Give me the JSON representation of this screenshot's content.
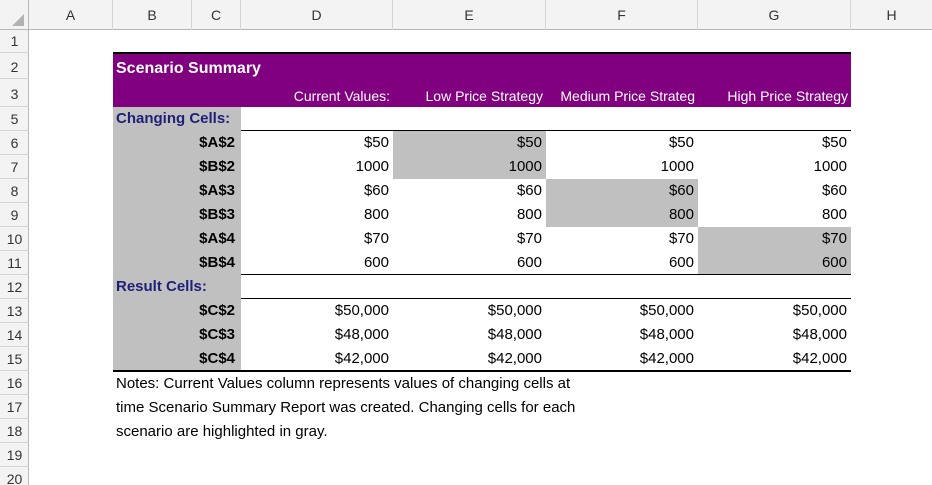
{
  "columns": [
    "A",
    "B",
    "C",
    "D",
    "E",
    "F",
    "G",
    "H"
  ],
  "rows": [
    "1",
    "2",
    "3",
    "5",
    "6",
    "7",
    "8",
    "9",
    "10",
    "11",
    "12",
    "13",
    "14",
    "15",
    "16",
    "17",
    "18",
    "19",
    "20"
  ],
  "report": {
    "title": "Scenario Summary",
    "column_titles": [
      "Current Values:",
      "Low Price Strategy",
      "Medium Price Strateg",
      "High Price Strategy"
    ],
    "changing_label": "Changing Cells:",
    "result_label": "Result Cells:",
    "changing_rows": [
      {
        "cell": "$A$2",
        "values": [
          "$50",
          "$50",
          "$50",
          "$50"
        ]
      },
      {
        "cell": "$B$2",
        "values": [
          "1000",
          "1000",
          "1000",
          "1000"
        ]
      },
      {
        "cell": "$A$3",
        "values": [
          "$60",
          "$60",
          "$60",
          "$60"
        ]
      },
      {
        "cell": "$B$3",
        "values": [
          "800",
          "800",
          "800",
          "800"
        ]
      },
      {
        "cell": "$A$4",
        "values": [
          "$70",
          "$70",
          "$70",
          "$70"
        ]
      },
      {
        "cell": "$B$4",
        "values": [
          "600",
          "600",
          "600",
          "600"
        ]
      }
    ],
    "result_rows": [
      {
        "cell": "$C$2",
        "values": [
          "$50,000",
          "$50,000",
          "$50,000",
          "$50,000"
        ]
      },
      {
        "cell": "$C$3",
        "values": [
          "$48,000",
          "$48,000",
          "$48,000",
          "$48,000"
        ]
      },
      {
        "cell": "$C$4",
        "values": [
          "$42,000",
          "$42,000",
          "$42,000",
          "$42,000"
        ]
      }
    ],
    "notes": [
      "Notes:  Current Values column represents values of changing cells at",
      "time Scenario Summary Report was created.  Changing cells for each",
      "scenario are highlighted in gray."
    ]
  },
  "colors": {
    "header_band": "#800080",
    "highlight_gray": "#c0c0c0",
    "section_label": "#1f1f7a"
  }
}
